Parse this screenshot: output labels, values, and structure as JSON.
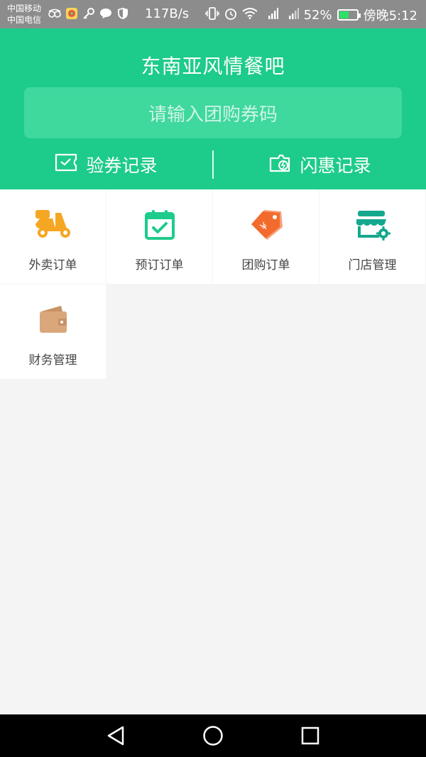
{
  "status_bar": {
    "carrier_1": "中国移动",
    "carrier_2": "中国电信",
    "speed": "117B/s",
    "battery": "52%",
    "battery_level": 0.52,
    "time": "傍晚5:12"
  },
  "header": {
    "title": "东南亚风情餐吧",
    "search_placeholder": "请输入团购券码",
    "link_left": "验券记录",
    "link_right": "闪惠记录",
    "bg_color": "#1dcb8a"
  },
  "grid": {
    "items": [
      {
        "label": "外卖订单",
        "icon": "scooter-icon"
      },
      {
        "label": "预订订单",
        "icon": "calendar-check-icon"
      },
      {
        "label": "团购订单",
        "icon": "price-tag-icon"
      },
      {
        "label": "门店管理",
        "icon": "store-settings-icon"
      },
      {
        "label": "财务管理",
        "icon": "wallet-icon"
      }
    ]
  },
  "colors": {
    "orange": "#f5a623",
    "green": "#1dcb8a",
    "tag_orange": "#f36b2c",
    "teal": "#14a88d",
    "wallet": "#d9a77a"
  }
}
